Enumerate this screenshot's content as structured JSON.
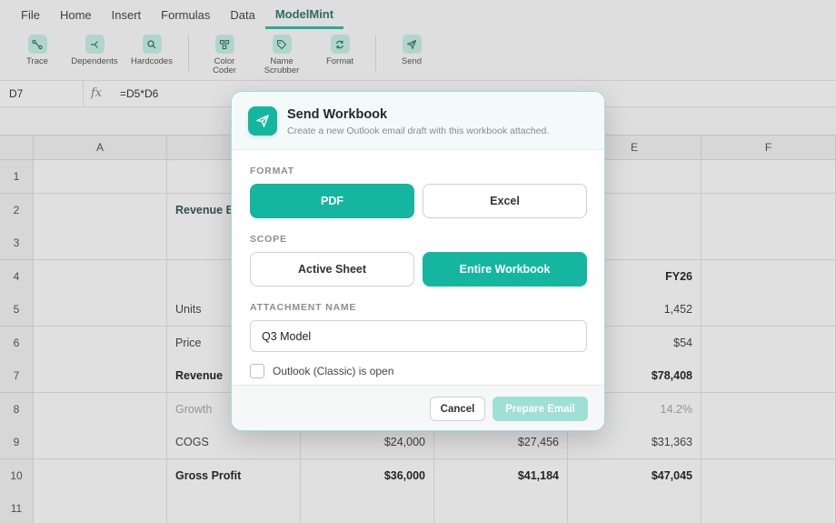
{
  "menu": [
    "File",
    "Home",
    "Insert",
    "Formulas",
    "Data",
    "ModelMint"
  ],
  "menu_active": "ModelMint",
  "ribbon": {
    "buttons": [
      {
        "label": "Trace",
        "icon": "trace-icon"
      },
      {
        "label": "Dependents",
        "icon": "dependents-icon"
      },
      {
        "label": "Hardcodes",
        "icon": "search-icon"
      },
      {
        "label": "Color Coder",
        "icon": "color-coder-icon"
      },
      {
        "label": "Name Scrubber",
        "icon": "tag-icon"
      },
      {
        "label": "Format",
        "icon": "refresh-icon"
      },
      {
        "label": "Send",
        "icon": "send-icon"
      }
    ]
  },
  "formula_bar": {
    "cell_ref": "D7",
    "fx": "fx",
    "formula": "=D5*D6"
  },
  "grid": {
    "columns": [
      "A",
      "",
      "",
      "",
      "E",
      "F"
    ],
    "rows": [
      {
        "num": "1",
        "cells": [
          "",
          "",
          "",
          "",
          "",
          ""
        ]
      },
      {
        "num": "2",
        "cells": [
          "",
          "Revenue B",
          "",
          "",
          "",
          ""
        ]
      },
      {
        "num": "3",
        "cells": [
          "",
          "",
          "",
          "",
          "",
          ""
        ]
      },
      {
        "num": "4",
        "cells": [
          "",
          "",
          "",
          "",
          "FY26",
          ""
        ]
      },
      {
        "num": "5",
        "cells": [
          "",
          "Units",
          "",
          "",
          "1,452",
          ""
        ]
      },
      {
        "num": "6",
        "cells": [
          "",
          "Price",
          "",
          "",
          "$54",
          ""
        ]
      },
      {
        "num": "7",
        "cells": [
          "",
          "Revenue",
          "",
          "",
          "$78,408",
          ""
        ]
      },
      {
        "num": "8",
        "cells": [
          "",
          "Growth",
          "",
          "",
          "14.2%",
          ""
        ]
      },
      {
        "num": "9",
        "cells": [
          "",
          "COGS",
          "$24,000",
          "$27,456",
          "$31,363",
          ""
        ]
      },
      {
        "num": "10",
        "cells": [
          "",
          "Gross Profit",
          "$36,000",
          "$41,184",
          "$47,045",
          ""
        ]
      },
      {
        "num": "11",
        "cells": [
          "",
          "",
          "",
          "",
          "",
          ""
        ]
      }
    ]
  },
  "dialog": {
    "title": "Send Workbook",
    "subtitle": "Create a new Outlook email draft with this workbook attached.",
    "format_label": "FORMAT",
    "format_options": [
      "PDF",
      "Excel"
    ],
    "format_selected": "PDF",
    "scope_label": "SCOPE",
    "scope_options": [
      "Active Sheet",
      "Entire Workbook"
    ],
    "scope_selected": "Entire Workbook",
    "attachment_label": "ATTACHMENT NAME",
    "attachment_value": "Q3 Model",
    "checkbox_label": "Outlook (Classic) is open",
    "checkbox_checked": false,
    "cancel_label": "Cancel",
    "primary_label": "Prepare Email"
  },
  "colors": {
    "accent": "#14b6a0",
    "accent_disabled": "#9ee0d6",
    "brand_text": "#1d6b58"
  }
}
